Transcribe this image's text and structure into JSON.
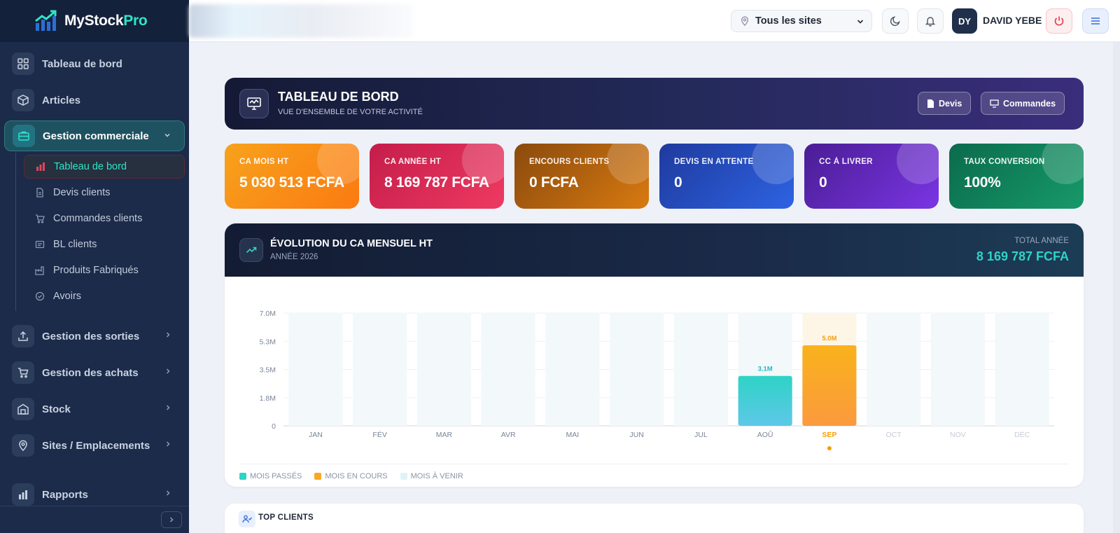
{
  "app": {
    "name_part1": "MyStock",
    "name_part2": "Pro"
  },
  "sidebar": {
    "items": [
      {
        "label": "Tableau de bord",
        "icon": "grid-icon"
      },
      {
        "label": "Articles",
        "icon": "box-icon"
      },
      {
        "label": "Gestion commerciale",
        "icon": "briefcase-icon",
        "active": true,
        "expanded": true
      },
      {
        "label": "Gestion des sorties",
        "icon": "upload-icon"
      },
      {
        "label": "Gestion des achats",
        "icon": "cart-icon"
      },
      {
        "label": "Stock",
        "icon": "warehouse-icon"
      },
      {
        "label": "Sites / Emplacements",
        "icon": "pin-icon"
      },
      {
        "label": "Rapports",
        "icon": "bar-chart-icon"
      }
    ],
    "sub_items": [
      {
        "label": "Tableau de bord",
        "icon": "bar-chart-icon",
        "active": true
      },
      {
        "label": "Devis clients",
        "icon": "document-icon"
      },
      {
        "label": "Commandes clients",
        "icon": "cart-icon"
      },
      {
        "label": "BL clients",
        "icon": "receipt-icon"
      },
      {
        "label": "Produits Fabriqués",
        "icon": "factory-icon"
      },
      {
        "label": "Avoirs",
        "icon": "check-circle-icon"
      }
    ]
  },
  "topbar": {
    "site_select": "Tous les sites",
    "user_initials": "DY",
    "user_name": "DAVID YEBE"
  },
  "header": {
    "title": "TABLEAU DE BORD",
    "subtitle": "VUE D'ENSEMBLE DE VOTRE ACTIVITÉ",
    "btn_devis": "Devis",
    "btn_commandes": "Commandes"
  },
  "kpis": [
    {
      "label": "CA MOIS HT",
      "value": "5 030 513 FCFA",
      "color_from": "#f7a21c",
      "color_to": "#fb7a12"
    },
    {
      "label": "CA ANNÉE HT",
      "value": "8 169 787 FCFA",
      "color_from": "#c41d4a",
      "color_to": "#ee3a62"
    },
    {
      "label": "ENCOURS CLIENTS",
      "value": "0 FCFA",
      "color_from": "#8a4a0d",
      "color_to": "#d87a10"
    },
    {
      "label": "DEVIS EN ATTENTE",
      "value": "0",
      "color_from": "#1f3a9e",
      "color_to": "#2d63e2"
    },
    {
      "label": "CC À LIVRER",
      "value": "0",
      "color_from": "#4a1d94",
      "color_to": "#7a35e4"
    },
    {
      "label": "TAUX CONVERSION",
      "value": "100%",
      "color_from": "#0b6b4c",
      "color_to": "#17996a"
    }
  ],
  "chart": {
    "title": "ÉVOLUTION DU CA MENSUEL HT",
    "subtitle": "ANNÉE 2026",
    "total_label": "TOTAL ANNÉE",
    "total_value": "8 169 787 FCFA",
    "legend": {
      "past": "MOIS PASSÉS",
      "current": "MOIS EN COURS",
      "future": "MOIS À VENIR"
    }
  },
  "chart_data": {
    "type": "bar",
    "categories": [
      "JAN",
      "FÉV",
      "MAR",
      "AVR",
      "MAI",
      "JUN",
      "JUL",
      "AOÛ",
      "SEP",
      "OCT",
      "NOV",
      "DÉC"
    ],
    "values": [
      0,
      0,
      0,
      0,
      0,
      0,
      0,
      3.1,
      5.0,
      0,
      0,
      0
    ],
    "value_labels": [
      "",
      "",
      "",
      "",
      "",
      "",
      "",
      "3.1M",
      "5.0M",
      "",
      "",
      ""
    ],
    "month_status": [
      "past",
      "past",
      "past",
      "past",
      "past",
      "past",
      "past",
      "past",
      "current",
      "future",
      "future",
      "future"
    ],
    "y_ticks": [
      "0",
      "1.8M",
      "3.5M",
      "5.3M",
      "7.0M"
    ],
    "y_tick_values": [
      0,
      1.75,
      3.5,
      5.25,
      7.0
    ],
    "ylim": [
      0,
      7.0
    ],
    "grid": true,
    "legend_placement": "bottom-left",
    "colors": {
      "past": "#2ed3c6",
      "current": "#f9a825",
      "future": "#dff3f6"
    }
  },
  "top_clients": {
    "title": "TOP CLIENTS"
  }
}
